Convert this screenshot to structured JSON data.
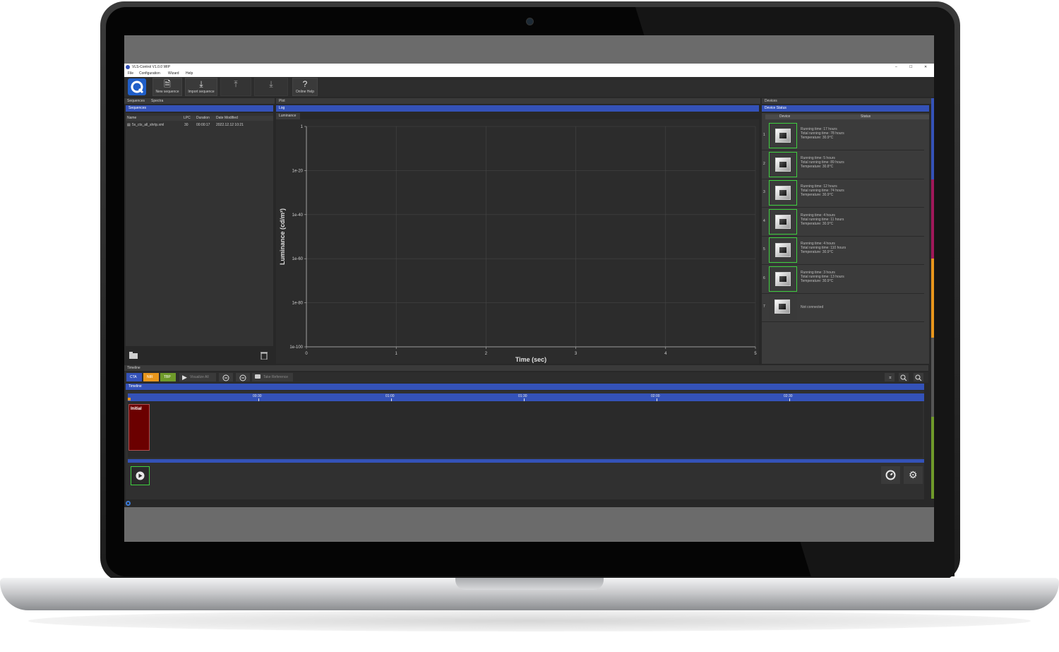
{
  "window": {
    "title": "VLS-Control V1.0.0 WIP",
    "controls": [
      "–",
      "☐",
      "✕"
    ]
  },
  "menu": [
    "File",
    "Configuration",
    "Wizard",
    "Help"
  ],
  "toolbar": {
    "buttons": [
      {
        "label": "New sequence",
        "icon": "new-sequence-icon"
      },
      {
        "label": "Import sequence",
        "icon": "import-icon"
      },
      {
        "label": "",
        "icon": "export-icon"
      },
      {
        "label": "",
        "icon": "save-icon"
      },
      {
        "label": "Online Help",
        "icon": "help-icon"
      }
    ]
  },
  "left_panel": {
    "tabs": [
      "Sequences",
      "Spectra"
    ],
    "header": "Sequences",
    "columns": [
      "Name",
      "LPC",
      "Duration",
      "Date Modified"
    ],
    "rows": [
      {
        "name": "5x_cts_all_shrtp.xml",
        "lpc": "30",
        "duration": "00:00:17",
        "modified": "2022.12.12 10:21"
      }
    ]
  },
  "plot_panel": {
    "tab": "Plot",
    "header": "Log",
    "subtab": "Luminance",
    "chart_data": {
      "type": "line",
      "xlabel": "Time (sec)",
      "ylabel": "Luminance (cd/m²)",
      "x_ticks": [
        "0",
        "1",
        "2",
        "3",
        "4",
        "5"
      ],
      "y_ticks": [
        "1",
        "1e-20",
        "1e-40",
        "1e-60",
        "1e-80",
        "1e-100"
      ],
      "xlim": [
        0,
        5
      ],
      "ylim": [
        1e-100,
        1
      ],
      "y_scale": "log",
      "grid": true,
      "series": []
    }
  },
  "devices_panel": {
    "tab": "Devices",
    "header": "Device Status",
    "columns": [
      "Device",
      "Status"
    ],
    "devices": [
      {
        "index": "1",
        "connected": true,
        "lines": [
          "Running time: 17 hours",
          "Total running time: 78 hours",
          "Temperature: 30.9°C"
        ]
      },
      {
        "index": "2",
        "connected": true,
        "lines": [
          "Running time: 5 hours",
          "Total running time: 89 hours",
          "Temperature: 30.8°C"
        ]
      },
      {
        "index": "3",
        "connected": true,
        "lines": [
          "Running time: 12 hours",
          "Total running time: 74 hours",
          "Temperature: 30.9°C"
        ]
      },
      {
        "index": "4",
        "connected": true,
        "lines": [
          "Running time: 4 hours",
          "Total running time: 11 hours",
          "Temperature: 30.9°C"
        ]
      },
      {
        "index": "5",
        "connected": true,
        "lines": [
          "Running time: 4 hours",
          "Total running time: 110 hours",
          "Temperature: 30.9°C"
        ]
      },
      {
        "index": "6",
        "connected": true,
        "lines": [
          "Running time: 3 hours",
          "Total running time: 13 hours",
          "Temperature: 30.9°C"
        ]
      },
      {
        "index": "7",
        "connected": false,
        "lines": [
          "Not connected"
        ]
      }
    ]
  },
  "timeline_panel": {
    "tab": "Timeline",
    "header": "Timeline",
    "mode_buttons": [
      {
        "label": "CTA",
        "color": "#3452b8"
      },
      {
        "label": "NIR",
        "color": "#e8961c"
      },
      {
        "label": "TBP",
        "color": "#6f9a2a"
      }
    ],
    "play_label": "Visualize All",
    "snapshot_label": "Take Reference",
    "ruler_ticks": [
      "00:30",
      "01:00",
      "01:30",
      "02:00",
      "02:30"
    ],
    "block_label": "Initial"
  },
  "colors": {
    "accent_blue": "#3452b8",
    "panel_bg": "#333333",
    "connected_green": "#3fcf3f",
    "initial_block": "#6b0000",
    "side_strip": [
      "#3452b8",
      "#a0185a",
      "#e8961c",
      "#6f9a2a"
    ]
  }
}
